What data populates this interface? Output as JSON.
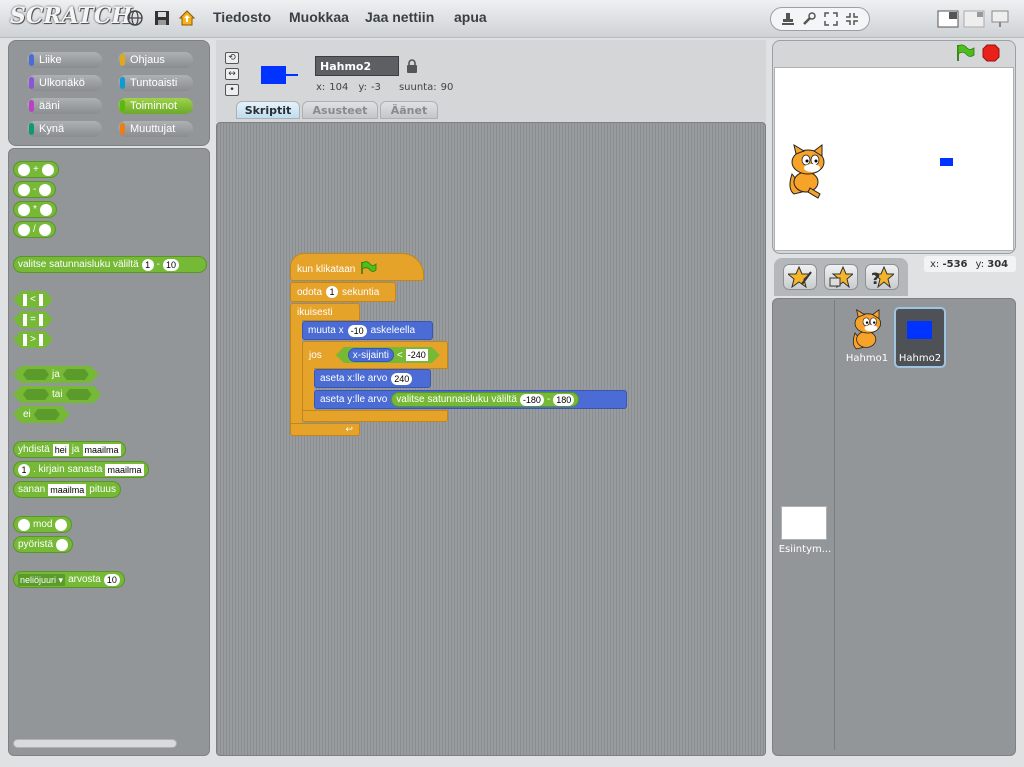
{
  "app": {
    "logo": "SCRATCH"
  },
  "menu": {
    "file": "Tiedosto",
    "edit": "Muokkaa",
    "share": "Jaa nettiin",
    "help": "apua"
  },
  "categories": [
    {
      "label": "Liike",
      "color": "#4a6cd4"
    },
    {
      "label": "Ohjaus",
      "color": "#e1a91a"
    },
    {
      "label": "Ulkonäkö",
      "color": "#8a55d7"
    },
    {
      "label": "Tuntoaisti",
      "color": "#0e9bd3"
    },
    {
      "label": "ääni",
      "color": "#bb42c3"
    },
    {
      "label": "Toiminnot",
      "color": "#5cb712"
    },
    {
      "label": "Kynä",
      "color": "#0e9a6c"
    },
    {
      "label": "Muuttujat",
      "color": "#ee7d16"
    }
  ],
  "palette": {
    "plus": "+",
    "minus": "-",
    "times": "*",
    "divide": "/",
    "random_text": "valitse satunnaisluku väliltä",
    "random_from": "1",
    "random_dash": "-",
    "random_to": "10",
    "lt": "<",
    "eq": "=",
    "gt": ">",
    "and": "ja",
    "or": "tai",
    "not": "ei",
    "join_text": "yhdistä",
    "join_a": "hei",
    "join_ja": "ja",
    "join_b": "maailma",
    "letter_num": "1",
    "letter_text": ". kirjain sanasta",
    "letter_word": "maailma",
    "length_pre": "sanan",
    "length_word": "maailma",
    "length_post": "pituus",
    "mod": "mod",
    "round": "pyöristä",
    "sqrt_fn": "neliöjuuri",
    "sqrt_of": "arvosta",
    "sqrt_val": "10"
  },
  "sprite": {
    "name": "Hahmo2",
    "x_label": "x:",
    "x": "104",
    "y_label": "y:",
    "y": "-3",
    "dir_label": "suunta:",
    "dir": "90"
  },
  "tabs": [
    "Skriptit",
    "Asusteet",
    "Äänet"
  ],
  "script": {
    "hat": "kun klikataan",
    "wait": "odota",
    "wait_val": "1",
    "wait_unit": "sekuntia",
    "forever": "ikuisesti",
    "move": "muuta x",
    "move_val": "-10",
    "move_unit": "askeleella",
    "if": "jos",
    "cond_left": "x-sijainti",
    "cond_op": "<",
    "cond_right": "-240",
    "setx": "aseta x:lle arvo",
    "setx_val": "240",
    "sety": "aseta y:lle arvo",
    "sety_rand": "valitse satunnaisluku väliltä",
    "sety_from": "-180",
    "sety_dash": "-",
    "sety_to": "180"
  },
  "stage": {
    "mouse_x_label": "x:",
    "mouse_x": "-536",
    "mouse_y_label": "y:",
    "mouse_y": "304"
  },
  "sprites": [
    {
      "name": "Hahmo1"
    },
    {
      "name": "Hahmo2"
    }
  ],
  "stage_thumb": {
    "label": "Esiintym..."
  },
  "colors": {
    "control": "#e5a32a",
    "motion": "#4a6cd4",
    "operators": "#75b936",
    "sprite_fill": "#0033ff"
  }
}
